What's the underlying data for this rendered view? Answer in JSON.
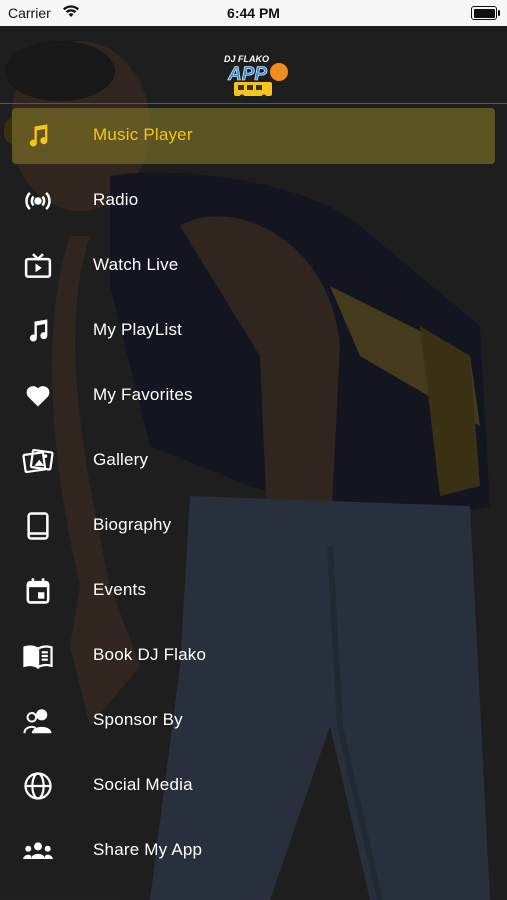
{
  "status_bar": {
    "carrier": "Carrier",
    "time": "6:44 PM"
  },
  "header": {
    "logo_line1": "DJ FLAKO",
    "logo_line2": "APP"
  },
  "menu": {
    "active_index": 0,
    "accent_color": "#f5c518",
    "items": [
      {
        "label": "Music Player",
        "icon": "music-note-icon"
      },
      {
        "label": "Radio",
        "icon": "radio-broadcast-icon"
      },
      {
        "label": "Watch Live",
        "icon": "tv-icon"
      },
      {
        "label": "My PlayList",
        "icon": "music-note-icon"
      },
      {
        "label": "My Favorites",
        "icon": "heart-icon"
      },
      {
        "label": "Gallery",
        "icon": "photos-icon"
      },
      {
        "label": "Biography",
        "icon": "book-icon"
      },
      {
        "label": "Events",
        "icon": "calendar-icon"
      },
      {
        "label": "Book DJ Flako",
        "icon": "open-book-icon"
      },
      {
        "label": "Sponsor By",
        "icon": "people-icon"
      },
      {
        "label": "Social Media",
        "icon": "globe-icon"
      },
      {
        "label": "Share My App",
        "icon": "group-icon"
      }
    ]
  }
}
